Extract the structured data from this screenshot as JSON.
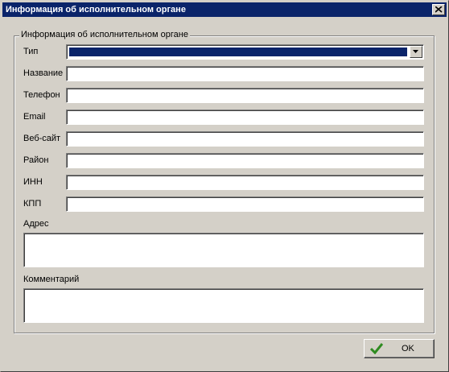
{
  "window": {
    "title": "Информация об исполнительном органе"
  },
  "group": {
    "title": "Информация об исполнительном органе"
  },
  "fields": {
    "type_label": "Тип",
    "name_label": "Название",
    "phone_label": "Телефон",
    "email_label": "Email",
    "website_label": "Веб-сайт",
    "district_label": "Район",
    "inn_label": "ИНН",
    "kpp_label": "КПП",
    "address_label": "Адрес",
    "comment_label": "Комментарий",
    "type_value": "",
    "name_value": "",
    "phone_value": "",
    "email_value": "",
    "website_value": "",
    "district_value": "",
    "inn_value": "",
    "kpp_value": "",
    "address_value": "",
    "comment_value": ""
  },
  "buttons": {
    "ok_label": "OK"
  },
  "icons": {
    "close": "close-icon",
    "combo": "chevron-down-icon",
    "ok": "checkmark-icon"
  },
  "colors": {
    "titlebar": "#0a246a",
    "face": "#d4d0c8",
    "check": "#2e8b20"
  }
}
